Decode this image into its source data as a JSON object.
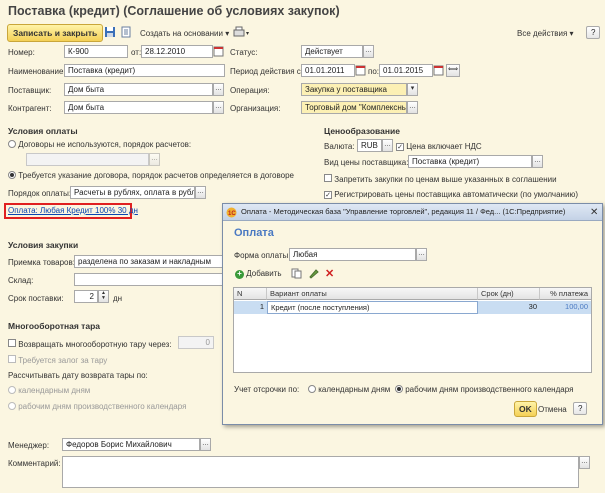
{
  "window": {
    "title": "Поставка (кредит) (Соглашение об условиях закупок)"
  },
  "toolbar": {
    "save_close": "Записать и закрыть",
    "create_based": "Создать на основании",
    "all_actions": "Все действия",
    "help": "?"
  },
  "fields": {
    "number_label": "Номер:",
    "number_value": "К-900",
    "date_from_label": "от:",
    "date_value": "28.12.2010",
    "status_label": "Статус:",
    "status_value": "Действует",
    "name_label": "Наименование:",
    "name_value": "Поставка (кредит)",
    "period_label": "Период действия с:",
    "period_from": "01.01.2011",
    "period_to_label": "по:",
    "period_to": "01.01.2015",
    "supplier_label": "Поставщик:",
    "supplier_value": "Дом быта",
    "operation_label": "Операция:",
    "operation_value": "Закупка у поставщика",
    "contractor_label": "Контрагент:",
    "contractor_value": "Дом быта",
    "org_label": "Организация:",
    "org_value": "Торговый дом \"Комплексный\""
  },
  "payment": {
    "title": "Условия оплаты",
    "opt1": "Договоры не используются, порядок расчетов:",
    "opt2": "Требуется указание договора, порядок расчетов определяется в договоре",
    "order_label": "Порядок оплаты:",
    "order_value": "Расчеты в рублях, оплата в рублях",
    "link": "Оплата: Любая Кредит 100% 30 дн"
  },
  "pricing": {
    "title": "Ценообразование",
    "currency_label": "Валюта:",
    "currency_value": "RUB",
    "vat_label": "Цена включает НДС",
    "price_type_label": "Вид цены поставщика:",
    "price_type_value": "Поставка (кредит)",
    "forbid_label": "Запретить закупки по ценам выше указанных в соглашении",
    "register_label": "Регистрировать цены поставщика автоматически (по умолчанию)"
  },
  "purchase": {
    "title": "Условия закупки",
    "receive_label": "Приемка товаров:",
    "receive_value": "разделена по заказам и накладным",
    "stock_label": "Склад:",
    "term_label": "Срок поставки:",
    "term_value": "2",
    "term_unit": "дн"
  },
  "tare": {
    "title": "Многооборотная тара",
    "return_label": "Возвращать многооборотную тару через:",
    "return_value": "0",
    "deposit_label": "Требуется залог за тару",
    "calc_label": "Рассчитывать дату возврата тары по:",
    "calendar_label": "календарным дням",
    "work_label": "рабочим дням производственного календаря"
  },
  "bottom": {
    "manager_label": "Менеджер:",
    "manager_value": "Федоров Борис Михайлович",
    "comment_label": "Комментарий:"
  },
  "dialog": {
    "title": "Оплата - Методическая база \"Управление торговлей\", редакция 11 / Фед... (1С:Предприятие)",
    "heading": "Оплата",
    "form_label": "Форма оплаты:",
    "form_value": "Любая",
    "add": "Добавить",
    "columns": [
      "N",
      "Вариант оплаты",
      "Срок (дн)",
      "% платежа"
    ],
    "rows": [
      {
        "n": "1",
        "variant": "Кредит (после поступления)",
        "days": "30",
        "percent": "100,00"
      }
    ],
    "delay_label": "Учет отсрочки по:",
    "delay_calendar": "календарным дням",
    "delay_work": "рабочим дням производственного календаря",
    "ok": "OK",
    "cancel": "Отмена",
    "help": "?"
  },
  "colors": {
    "accent": "#f4d056",
    "selection": "#c9ddf2",
    "link": "#0a45b0",
    "highlight_box": "#e02020"
  }
}
